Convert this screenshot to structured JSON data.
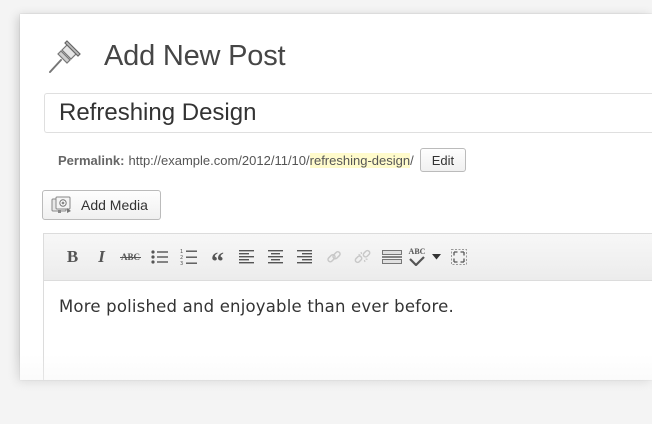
{
  "page": {
    "title": "Add New Post"
  },
  "post": {
    "title_value": "Refreshing Design",
    "permalink_label": "Permalink:",
    "permalink_base": "http://example.com/2012/11/10/",
    "permalink_slug": "refreshing-design",
    "permalink_trailing": "/",
    "edit_label": "Edit"
  },
  "media": {
    "add_label": "Add Media"
  },
  "toolbar": {
    "bold_label": "B",
    "italic_label": "I",
    "strike_label": "ABC",
    "blockquote_label": "“",
    "spell_label": "ABC",
    "icons": [
      "bold-icon",
      "italic-icon",
      "strikethrough-icon",
      "bullet-list-icon",
      "numbered-list-icon",
      "blockquote-icon",
      "align-left-icon",
      "align-center-icon",
      "align-right-icon",
      "link-icon",
      "unlink-icon",
      "more-tag-icon",
      "spellcheck-icon",
      "dropdown-arrow-icon",
      "fullscreen-icon"
    ]
  },
  "editor": {
    "content": "More polished and enjoyable than ever before."
  },
  "colors": {
    "slug_highlight": "#fffbcc",
    "toolbar_icon": "#555555",
    "heading": "#464646"
  }
}
